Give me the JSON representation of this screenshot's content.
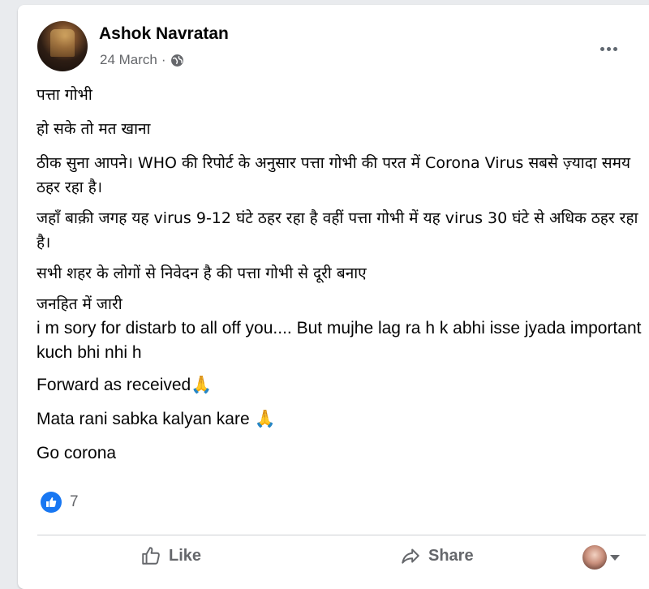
{
  "post": {
    "author": "Ashok Navratan",
    "date": "24 March",
    "date_separator": "·",
    "audience_icon": "globe-icon",
    "more_icon": "more-options-icon",
    "paragraphs": [
      "पत्ता गोभी",
      "हो सके तो मत खाना",
      "ठीक सुना आपने। WHO की रिपोर्ट के अनुसार पत्ता गोभी की परत में Corona Virus सबसे ज़्यादा समय ठहर रहा है।",
      "जहाँ बाक़ी जगह यह virus 9-12 घंटे ठहर रहा है वहीं पत्ता गोभी में यह virus 30 घंटे से अधिक ठहर रहा है।",
      "सभी शहर के लोगों से निवेदन है की पत्ता गोभी से दूरी बनाए",
      "जनहित में जारी",
      " i m sory for distarb to all off you.... But mujhe lag ra h k abhi isse jyada important kuch bhi nhi h",
      "Forward as received🙏",
      "Mata rani sabka kalyan kare 🙏",
      "Go corona"
    ]
  },
  "reactions": {
    "icon": "like-reaction-icon",
    "count": "7",
    "color": "#1877f2"
  },
  "actions": {
    "like_label": "Like",
    "share_label": "Share"
  }
}
